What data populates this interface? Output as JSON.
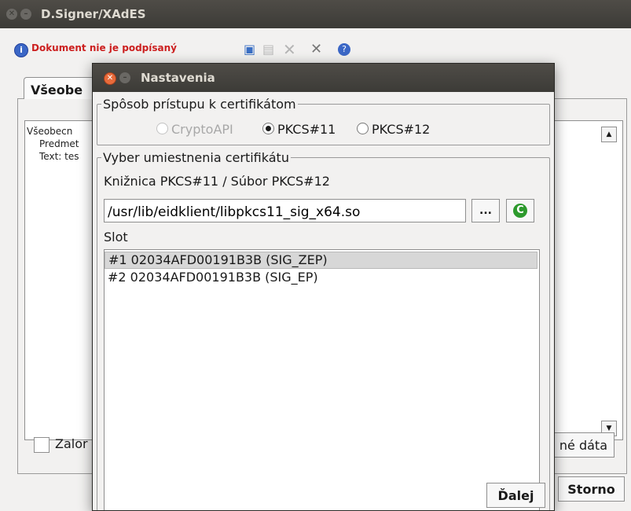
{
  "main_window": {
    "title": "D.Signer/XAdES",
    "status": "Dokument nie je podpísaný",
    "toolbar_icons": [
      "sign-document-icon",
      "document-icon",
      "delete-icon",
      "tools-icon",
      "help-icon"
    ],
    "tab_label": "Všeobe",
    "content_lines": [
      "Všeobecn",
      "Predmet",
      "Text: tes"
    ],
    "attach_label": "Zalor",
    "data_button_label": "né dáta",
    "cancel_label": "Storno"
  },
  "dialog": {
    "title": "Nastavenia",
    "access_group": {
      "legend": "Spôsob prístupu k certifikátom",
      "options": [
        {
          "label": "CryptoAPI",
          "selected": false,
          "enabled": false
        },
        {
          "label": "PKCS#11",
          "selected": true,
          "enabled": true
        },
        {
          "label": "PKCS#12",
          "selected": false,
          "enabled": true
        }
      ]
    },
    "location_group": {
      "legend": "Vyber umiestnenia certifikátu",
      "library_label": "Knižnica PKCS#11 / Súbor PKCS#12",
      "library_path": "/usr/lib/eidklient/libpkcs11_sig_x64.so",
      "browse_label": "...",
      "slot_label": "Slot",
      "slots": [
        {
          "label": "#1 02034AFD00191B3B (SIG_ZEP)",
          "selected": true
        },
        {
          "label": "#2 02034AFD00191B3B (SIG_EP)",
          "selected": false
        }
      ]
    },
    "next_label": "Ďalej"
  },
  "colors": {
    "titlebar": "#3c3b37",
    "status_text": "#cc1f1f",
    "close_button": "#e86b3b"
  }
}
